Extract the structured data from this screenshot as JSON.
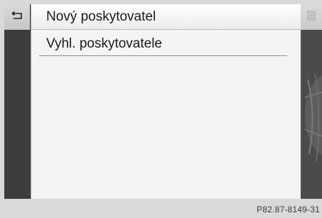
{
  "nav": {
    "back_icon": "back-arrow-icon",
    "right_icon": "list-icon"
  },
  "menu": {
    "items": [
      {
        "label": "Nový poskytovatel",
        "selected": true
      },
      {
        "label": "Vyhl. poskytovatele",
        "selected": false
      }
    ]
  },
  "footer": {
    "code": "P82.87-8149-31"
  },
  "colors": {
    "panel": "#f4f4f4",
    "frame": "#3a3b3c",
    "background": "#d8d9d9"
  }
}
